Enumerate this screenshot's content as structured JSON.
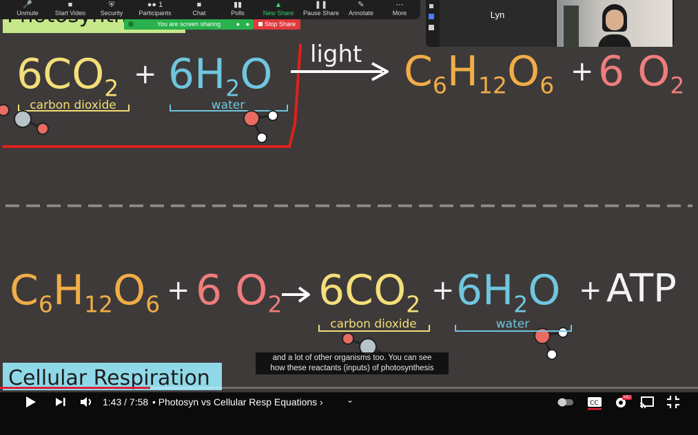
{
  "zoom_toolbar": {
    "items": [
      {
        "label": "Unmute",
        "icon": "mic-muted-icon"
      },
      {
        "label": "Start Video",
        "icon": "video-off-icon"
      },
      {
        "label": "Security",
        "icon": "shield-icon"
      },
      {
        "label": "Participants",
        "icon": "participants-icon"
      },
      {
        "label": "Chat",
        "icon": "chat-icon"
      },
      {
        "label": "Polls",
        "icon": "polls-icon"
      },
      {
        "label": "New Share",
        "icon": "share-up-icon"
      },
      {
        "label": "Pause Share",
        "icon": "pause-icon"
      },
      {
        "label": "Annotate",
        "icon": "pen-icon"
      },
      {
        "label": "More",
        "icon": "more-icon"
      }
    ],
    "sharing_status": "You are screen sharing",
    "stop_share": "Stop Share",
    "participant_count": "1"
  },
  "participants": {
    "name": "Lyn"
  },
  "board": {
    "photosynthesis_label": "Photosynthesis",
    "light_label": "light",
    "eq1": {
      "r1_coef": "6CO",
      "r1_sub": "2",
      "plus1": "+",
      "r2_coef": "6H",
      "r2_sub": "2",
      "r2_tail": "O",
      "p1_a": "C",
      "p1_s1": "6",
      "p1_b": "H",
      "p1_s2": "12",
      "p1_c": "O",
      "p1_s3": "6",
      "plus2": "+",
      "p2_coef": "6 O",
      "p2_sub": "2",
      "label_co2": "carbon dioxide",
      "label_water": "water"
    },
    "eq2": {
      "r1_a": "C",
      "r1_s1": "6",
      "r1_b": "H",
      "r1_s2": "12",
      "r1_c": "O",
      "r1_s3": "6",
      "plus1": "+",
      "r2_coef": "6 O",
      "r2_sub": "2",
      "p1_coef": "6CO",
      "p1_sub": "2",
      "plus2": "+",
      "p2_coef": "6H",
      "p2_sub": "2",
      "p2_tail": "O",
      "plus3": "+",
      "atp": "ATP",
      "label_co2": "carbon dioxide",
      "label_water": "water"
    },
    "cellular_label": "Cellular Respiration",
    "colors": {
      "yellow": "#f3de7a",
      "blue": "#6fc6df",
      "orange": "#f0ad47",
      "pink": "#ef7d7d",
      "red_line": "#e1201b"
    }
  },
  "caption": {
    "line1": "and a lot of other organisms too. You can see",
    "line2": "how these reactants (inputs) of photosynthesis"
  },
  "player": {
    "time": "1:43 / 7:58",
    "chapter": "• Photosyn vs Cellular Resp Equations ›",
    "progress_fraction": 0.2155,
    "hd_badge": "HD",
    "accent": "#e0203a"
  }
}
